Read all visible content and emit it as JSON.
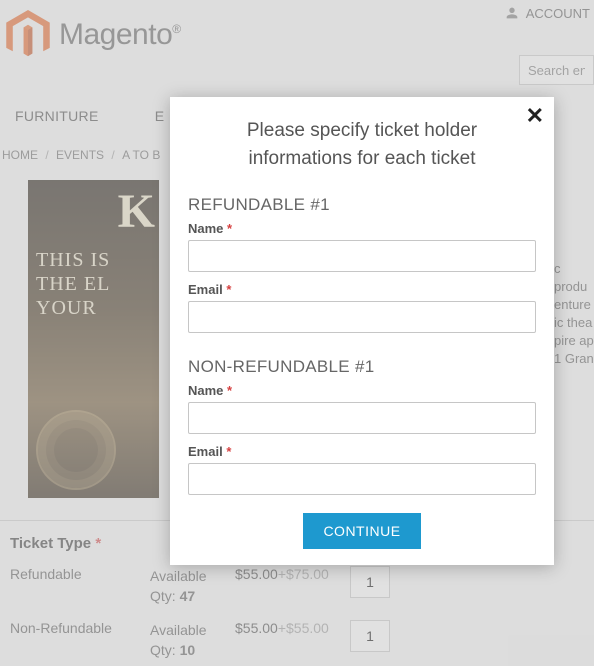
{
  "header": {
    "account_label": "ACCOUNT",
    "logo_text": "Magento",
    "search_placeholder": "Search en"
  },
  "nav": {
    "item1": "FURNITURE",
    "item2": "E"
  },
  "breadcrumb": {
    "home": "HOME",
    "events": "EVENTS",
    "current": "A TO B"
  },
  "product": {
    "image_letter": "K",
    "image_tagline": "THIS IS\nTHE EL\nYOUR",
    "desc_line1": "c produ",
    "desc_line2": "enture",
    "desc_line3": "ic thea",
    "desc_line4": "pire ap",
    "desc_line5": "1 Gran"
  },
  "ticket": {
    "type_label": "Ticket Type",
    "options": [
      {
        "name": "Refundable",
        "avail_label": "Available Qty:",
        "avail_qty": "47",
        "base_price": "$55.00",
        "extra_price": "+$75.00",
        "qty": "1"
      },
      {
        "name": "Non-Refundable",
        "avail_label": "Available Qty:",
        "avail_qty": "10",
        "base_price": "$55.00",
        "extra_price": "+$55.00",
        "qty": "1"
      }
    ]
  },
  "modal": {
    "title": "Please specify ticket holder informations for each ticket",
    "sections": [
      {
        "title": "REFUNDABLE #1",
        "name_label": "Name",
        "name_value": "",
        "email_label": "Email",
        "email_value": ""
      },
      {
        "title": "NON-REFUNDABLE #1",
        "name_label": "Name",
        "name_value": "",
        "email_label": "Email",
        "email_value": ""
      }
    ],
    "continue_label": "CONTINUE"
  }
}
